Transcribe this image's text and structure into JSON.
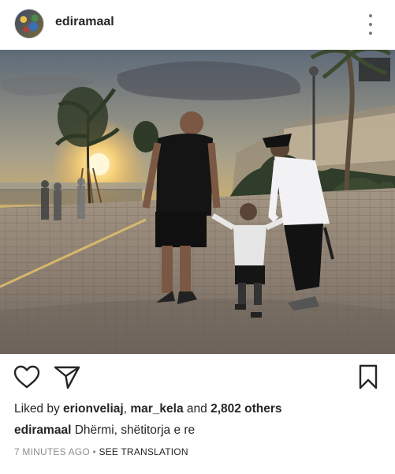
{
  "post": {
    "username": "ediramaal",
    "liked_by_prefix": "Liked by ",
    "liked_users": [
      "erionveliaj",
      "mar_kela"
    ],
    "liked_sep": ", ",
    "liked_and": " and ",
    "liked_others": "2,802 others",
    "caption_author": "ediramaal",
    "caption_text": " Dhërmi, shëtitorja e re",
    "timestamp": "7 MINUTES AGO",
    "meta_sep": " • ",
    "see_translation": "SEE TRANSLATION"
  },
  "icons": {
    "more": "more-vertical-icon",
    "like": "heart-icon",
    "share": "send-icon",
    "save": "bookmark-icon"
  },
  "colors": {
    "text": "#262626",
    "muted": "#8e8e8e"
  }
}
